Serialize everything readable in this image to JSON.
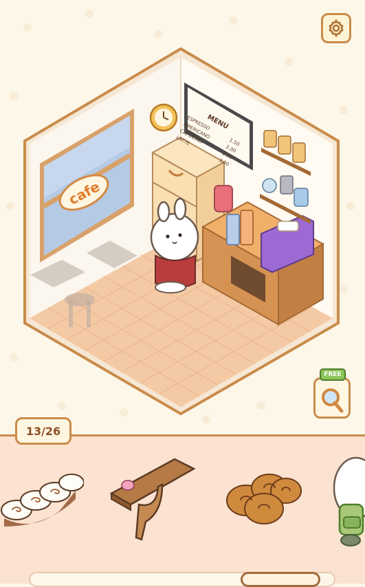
{
  "room": {
    "sign_text": "cafe",
    "menu": {
      "title": "MENU",
      "items": [
        {
          "name": "ESPRESSO",
          "price": "1.50"
        },
        {
          "name": "AMERICANO",
          "price": "2.00"
        },
        {
          "name": "CAPUCINO",
          "price": "2.50"
        },
        {
          "name": "LATTE",
          "price": "3.00"
        }
      ]
    }
  },
  "hint": {
    "badge": "FREE",
    "icon": "magnifier-icon"
  },
  "settings": {
    "icon": "gear-icon"
  },
  "progress": {
    "label": "13/26",
    "found": 13,
    "total": 26
  },
  "tray": {
    "items": [
      "cinnamon-rolls",
      "wall-shelf",
      "palmier-cookies",
      "bunny-backpack"
    ],
    "scroll_position": 0.75
  },
  "colors": {
    "accent": "#c98b4a",
    "background": "#fdf7e9",
    "tray": "#fce2d0",
    "floor": "#f3c9a2"
  }
}
